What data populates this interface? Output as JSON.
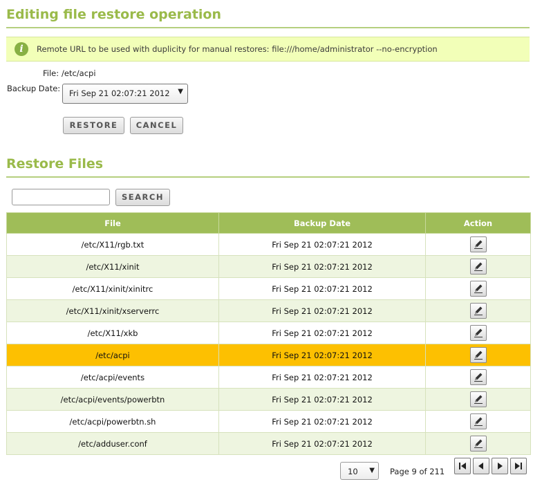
{
  "page": {
    "title": "Editing file restore operation",
    "info_message": "Remote URL to be used with duplicity for manual restores: file:///home/administrator --no-encryption",
    "info_icon": "info-icon"
  },
  "form": {
    "file_label": "File:",
    "file_value": "/etc/acpi",
    "backup_date_label": "Backup Date:",
    "backup_date_value": "Fri Sep 21 02:07:21 2012",
    "restore_button": "RESTORE",
    "cancel_button": "CANCEL"
  },
  "restore_files": {
    "title": "Restore Files",
    "search_value": "",
    "search_button": "SEARCH"
  },
  "table": {
    "headers": {
      "file": "File",
      "backup_date": "Backup Date",
      "action": "Action"
    },
    "rows": [
      {
        "file": "/etc/X11/rgb.txt",
        "date": "Fri Sep 21 02:07:21 2012"
      },
      {
        "file": "/etc/X11/xinit",
        "date": "Fri Sep 21 02:07:21 2012"
      },
      {
        "file": "/etc/X11/xinit/xinitrc",
        "date": "Fri Sep 21 02:07:21 2012"
      },
      {
        "file": "/etc/X11/xinit/xserverrc",
        "date": "Fri Sep 21 02:07:21 2012"
      },
      {
        "file": "/etc/X11/xkb",
        "date": "Fri Sep 21 02:07:21 2012"
      },
      {
        "file": "/etc/acpi",
        "date": "Fri Sep 21 02:07:21 2012",
        "selected": true
      },
      {
        "file": "/etc/acpi/events",
        "date": "Fri Sep 21 02:07:21 2012"
      },
      {
        "file": "/etc/acpi/events/powerbtn",
        "date": "Fri Sep 21 02:07:21 2012"
      },
      {
        "file": "/etc/acpi/powerbtn.sh",
        "date": "Fri Sep 21 02:07:21 2012"
      },
      {
        "file": "/etc/adduser.conf",
        "date": "Fri Sep 21 02:07:21 2012"
      }
    ]
  },
  "pagination": {
    "page_size": "10",
    "page_text": "Page 9 of 211"
  },
  "colors": {
    "accent": "#9aba4a",
    "header_bg": "#9fbd58",
    "selected_row": "#fdc001",
    "info_bg": "#f2ffb8"
  }
}
